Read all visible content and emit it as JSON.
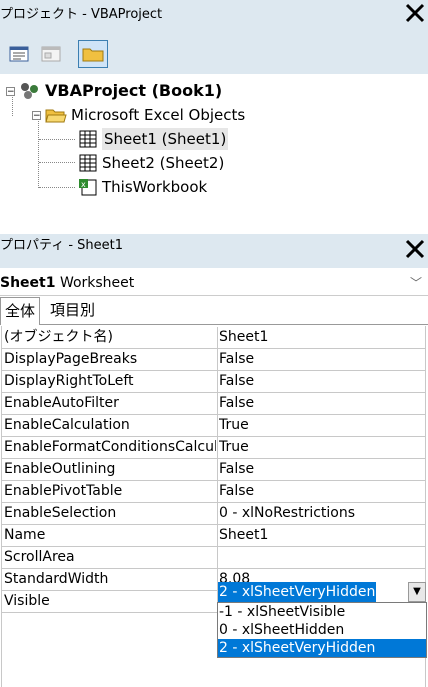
{
  "project_explorer": {
    "title": "プロジェクト - VBAProject",
    "close_label": "✕",
    "toolbar": {
      "view_code_icon": "view-code-icon",
      "view_object_icon": "view-object-icon",
      "toggle_folders_icon": "folder-icon"
    },
    "tree": {
      "project": "VBAProject (Book1)",
      "folder": "Microsoft Excel Objects",
      "items": [
        "Sheet1 (Sheet1)",
        "Sheet2 (Sheet2)",
        "ThisWorkbook"
      ]
    }
  },
  "properties": {
    "title": "プロパティ - Sheet1",
    "close_label": "✕",
    "object_name": "Sheet1",
    "object_type": "Worksheet",
    "tabs": [
      "全体",
      "項目別"
    ],
    "rows": [
      {
        "name": "(オブジェクト名)",
        "value": "Sheet1"
      },
      {
        "name": "DisplayPageBreaks",
        "value": "False"
      },
      {
        "name": "DisplayRightToLeft",
        "value": "False"
      },
      {
        "name": "EnableAutoFilter",
        "value": "False"
      },
      {
        "name": "EnableCalculation",
        "value": "True"
      },
      {
        "name": "EnableFormatConditionsCalculation",
        "value": "True"
      },
      {
        "name": "EnableOutlining",
        "value": "False"
      },
      {
        "name": "EnablePivotTable",
        "value": "False"
      },
      {
        "name": "EnableSelection",
        "value": "0 - xlNoRestrictions"
      },
      {
        "name": "Name",
        "value": "Sheet1"
      },
      {
        "name": "ScrollArea",
        "value": ""
      },
      {
        "name": "StandardWidth",
        "value": "8.08"
      },
      {
        "name": "Visible",
        "value": ""
      }
    ],
    "visible_current": "2 - xlSheetVeryHidden",
    "visible_options": [
      "-1 - xlSheetVisible",
      "0 - xlSheetHidden",
      "2 - xlSheetVeryHidden"
    ],
    "selection_color": "#0078d7"
  }
}
